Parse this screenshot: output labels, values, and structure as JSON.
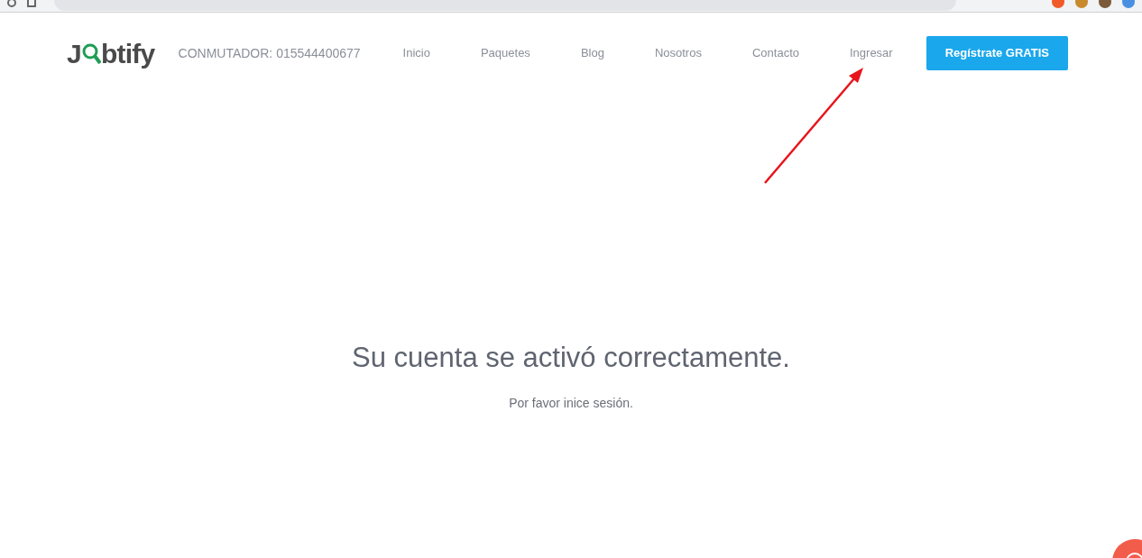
{
  "logo": {
    "before": "J",
    "after": "btify"
  },
  "phone": "CONMUTADOR: 015544400677",
  "nav": [
    {
      "label": "Inicio"
    },
    {
      "label": "Paquetes"
    },
    {
      "label": "Blog"
    },
    {
      "label": "Nosotros"
    },
    {
      "label": "Contacto"
    },
    {
      "label": "Ingresar"
    }
  ],
  "cta": "Regístrate GRATIS",
  "message": {
    "title": "Su cuenta se activó correctamente.",
    "subtitle": "Por favor inice sesión."
  }
}
